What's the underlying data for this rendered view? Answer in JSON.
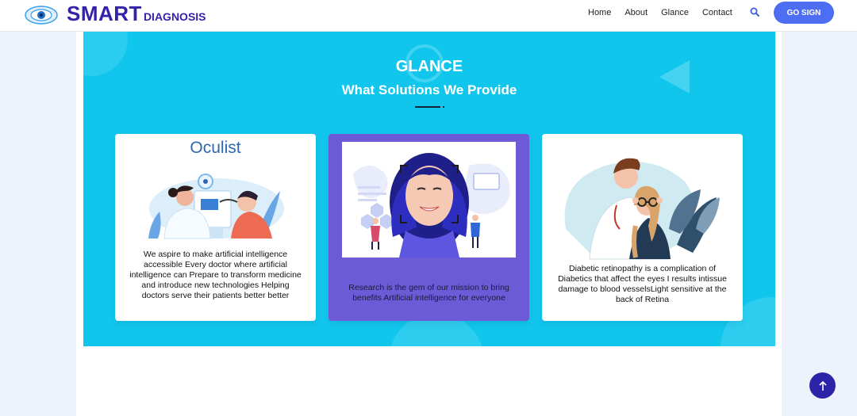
{
  "header": {
    "brand_main": "SMART",
    "brand_sub": "DIAGNOSIS",
    "logo_icon": "eye-logo-icon",
    "nav": [
      "Home",
      "About",
      "Glance",
      "Contact"
    ],
    "search_icon": "search-icon",
    "cta_label": "GO SIGN"
  },
  "section": {
    "title": "GLANCE",
    "subtitle": "What Solutions We Provide"
  },
  "cards": [
    {
      "illustration_title": "Oculist",
      "illustration": "oculist-eye-exam-illustration",
      "text": "We aspire to make artificial intelligence accessible Every doctor where artificial intelligence can Prepare to transform medicine and introduce new technologies Helping doctors serve their patients better better"
    },
    {
      "illustration": "face-recognition-illustration",
      "text": "Research is the gem of our mission to bring benefits Artificial intelligence for everyone"
    },
    {
      "illustration": "doctor-patient-eyeglasses-illustration",
      "text": "Diabetic retinopathy is a complication of Diabetics that affect the eyes I results intissue damage to blood vesselsLight sensitive at the back of Retina"
    }
  ],
  "scroll_top_icon": "arrow-up-icon",
  "colors": {
    "brand": "#3422a8",
    "accent_button": "#4d6ef2",
    "hero_bg": "#11c6ed",
    "highlight_card": "#6c5ad6",
    "scroll_button": "#2c24a8"
  }
}
